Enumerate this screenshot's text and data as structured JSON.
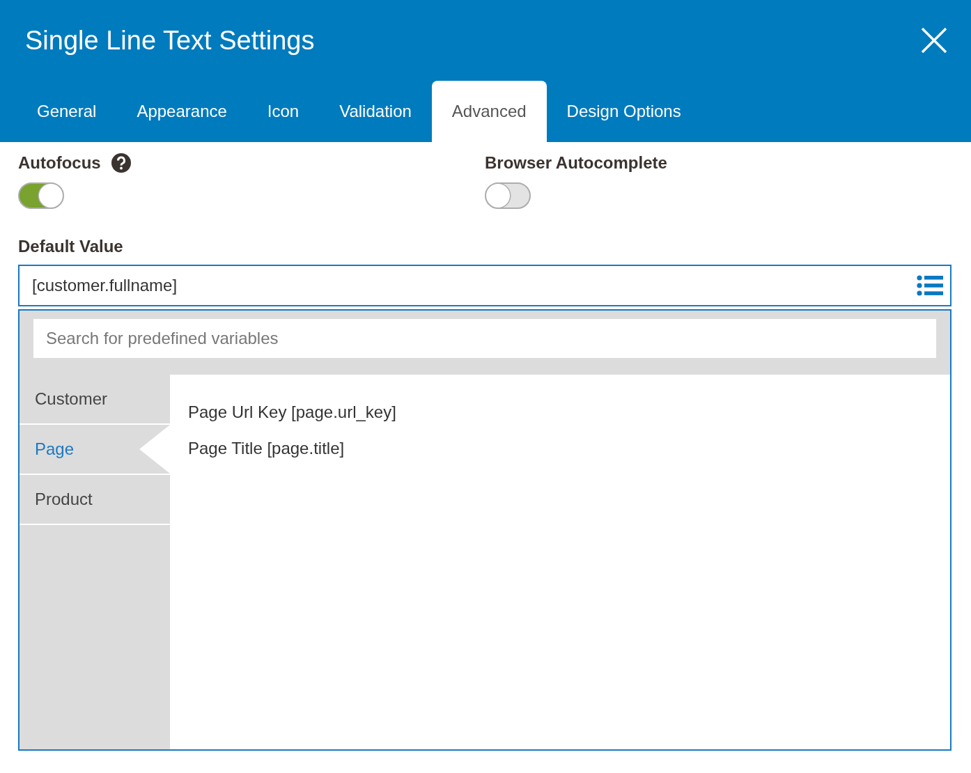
{
  "window": {
    "title": "Single Line Text Settings"
  },
  "tabs": [
    {
      "label": "General",
      "selected": false
    },
    {
      "label": "Appearance",
      "selected": false
    },
    {
      "label": "Icon",
      "selected": false
    },
    {
      "label": "Validation",
      "selected": false
    },
    {
      "label": "Advanced",
      "selected": true
    },
    {
      "label": "Design Options",
      "selected": false
    }
  ],
  "toggles": [
    {
      "label": "Autofocus",
      "help": true,
      "on": true
    },
    {
      "label": "Browser Autocomplete",
      "help": false,
      "on": false
    }
  ],
  "default_value": {
    "label": "Default Value",
    "value": "[customer.fullname]"
  },
  "variables": {
    "search": {
      "placeholder": "Search for predefined variables"
    },
    "categories": [
      {
        "label": "Customer",
        "selected": false
      },
      {
        "label": "Page",
        "selected": true
      },
      {
        "label": "Product",
        "selected": false
      }
    ],
    "items": [
      "Page Url Key [page.url_key]",
      "Page Title [page.title]"
    ]
  }
}
